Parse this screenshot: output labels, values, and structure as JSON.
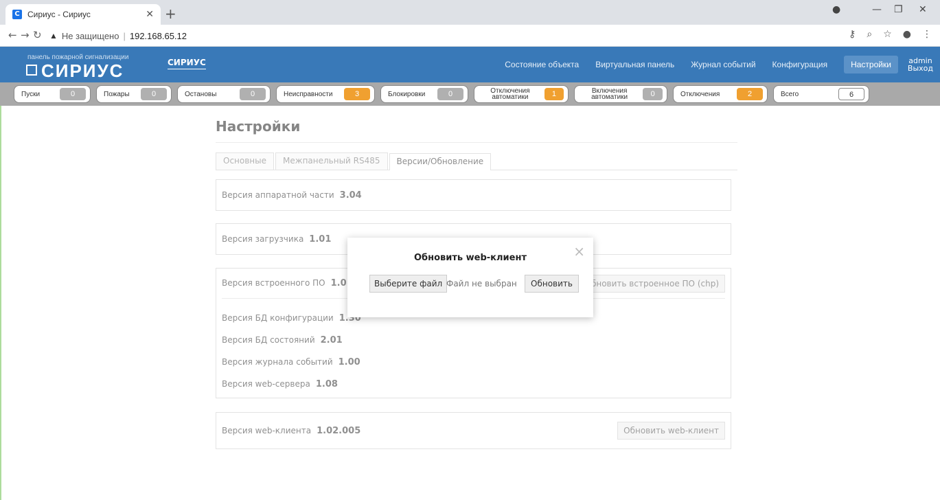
{
  "browser": {
    "tab_title": "Сириус - Сириус",
    "favicon": "С",
    "insecure_label": "Не защищено",
    "url": "192.168.65.12"
  },
  "app": {
    "subtitle": "панель пожарной сигнализации",
    "logo": "СИРИУС",
    "brand": "СИРИУС",
    "nav": [
      {
        "label": "Состояние объекта"
      },
      {
        "label": "Виртуальная панель"
      },
      {
        "label": "Журнал событий"
      },
      {
        "label": "Конфигурация"
      },
      {
        "label": "Настройки"
      }
    ],
    "user": {
      "name": "admin",
      "logout": "Выход"
    }
  },
  "counters": [
    {
      "label": "Пуски",
      "value": "0"
    },
    {
      "label": "Пожары",
      "value": "0"
    },
    {
      "label": "Остановы",
      "value": "0"
    },
    {
      "label": "Неисправности",
      "value": "3"
    },
    {
      "label": "Блокировки",
      "value": "0"
    },
    {
      "label": "Отключения автоматики",
      "value": "1"
    },
    {
      "label": "Включения автоматики",
      "value": "0"
    },
    {
      "label": "Отключения",
      "value": "2"
    },
    {
      "label": "Всего",
      "value": "6"
    }
  ],
  "page": {
    "title": "Настройки",
    "tabs": [
      {
        "label": "Основные"
      },
      {
        "label": "Межпанельный RS485"
      },
      {
        "label": "Версии/Обновление"
      }
    ],
    "hw_version_label": "Версия аппаратной части",
    "hw_version": "3.04",
    "loader_label": "Версия загрузчика",
    "loader": "1.01",
    "fw_label": "Версия встроенного ПО",
    "fw": "1.01.0",
    "fw_button": "Обновить встроенное ПО (chp)",
    "db_cfg_label": "Версия БД конфигурации",
    "db_cfg": "1.30",
    "db_state_label": "Версия БД состояний",
    "db_state": "2.01",
    "journal_label": "Версия журнала событий",
    "journal": "1.00",
    "web_server_label": "Версия web-сервера",
    "web_server": "1.08",
    "web_client_label": "Версия web-клиента",
    "web_client": "1.02.005",
    "web_client_button": "Обновить web-клиент"
  },
  "dialog": {
    "title": "Обновить web-клиент",
    "choose_file": "Выберите файл",
    "no_file": "Файл не выбран",
    "apply": "Обновить"
  }
}
